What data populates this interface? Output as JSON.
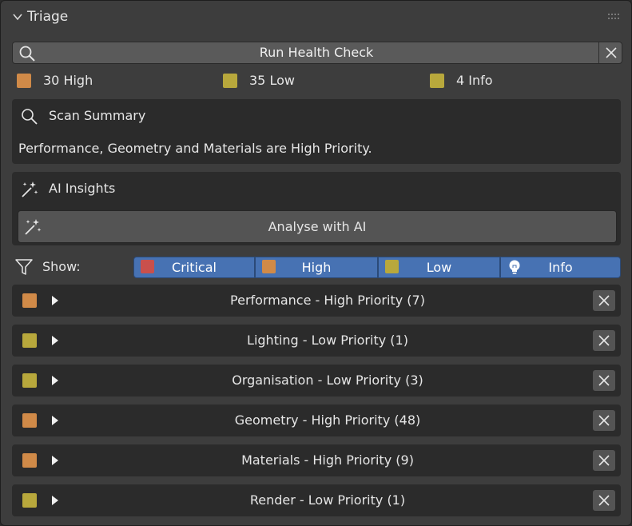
{
  "panel": {
    "title": "Triage"
  },
  "run": {
    "label": "Run Health Check"
  },
  "counts": [
    {
      "label": "30 High",
      "color": "#d08a48"
    },
    {
      "label": "35 Low",
      "color": "#b8a83c"
    },
    {
      "label": "4 Info",
      "color": "#b8a83c"
    }
  ],
  "scan": {
    "heading": "Scan Summary",
    "text": "Performance, Geometry and Materials are High Priority."
  },
  "ai": {
    "heading": "AI Insights",
    "button": "Analyse with AI"
  },
  "filters": {
    "label": "Show:",
    "options": [
      {
        "label": "Critical",
        "color": "#c9504c"
      },
      {
        "label": "High",
        "color": "#d08a48"
      },
      {
        "label": "Low",
        "color": "#b8a83c"
      },
      {
        "label": "Info",
        "icon": "lightbulb-icon"
      }
    ]
  },
  "issues": [
    {
      "category": "Performance",
      "priority": "High Priority",
      "count": "(7)",
      "color": "#d08a48"
    },
    {
      "category": "Lighting",
      "priority": "Low Priority",
      "count": "(1)",
      "color": "#b8a83c"
    },
    {
      "category": "Organisation",
      "priority": "Low Priority",
      "count": "(3)",
      "color": "#b8a83c"
    },
    {
      "category": "Geometry",
      "priority": "High Priority",
      "count": "(48)",
      "color": "#d08a48"
    },
    {
      "category": "Materials",
      "priority": "High Priority",
      "count": "(9)",
      "color": "#d08a48"
    },
    {
      "category": "Render",
      "priority": "Low Priority",
      "count": "(1)",
      "color": "#b8a83c"
    }
  ]
}
